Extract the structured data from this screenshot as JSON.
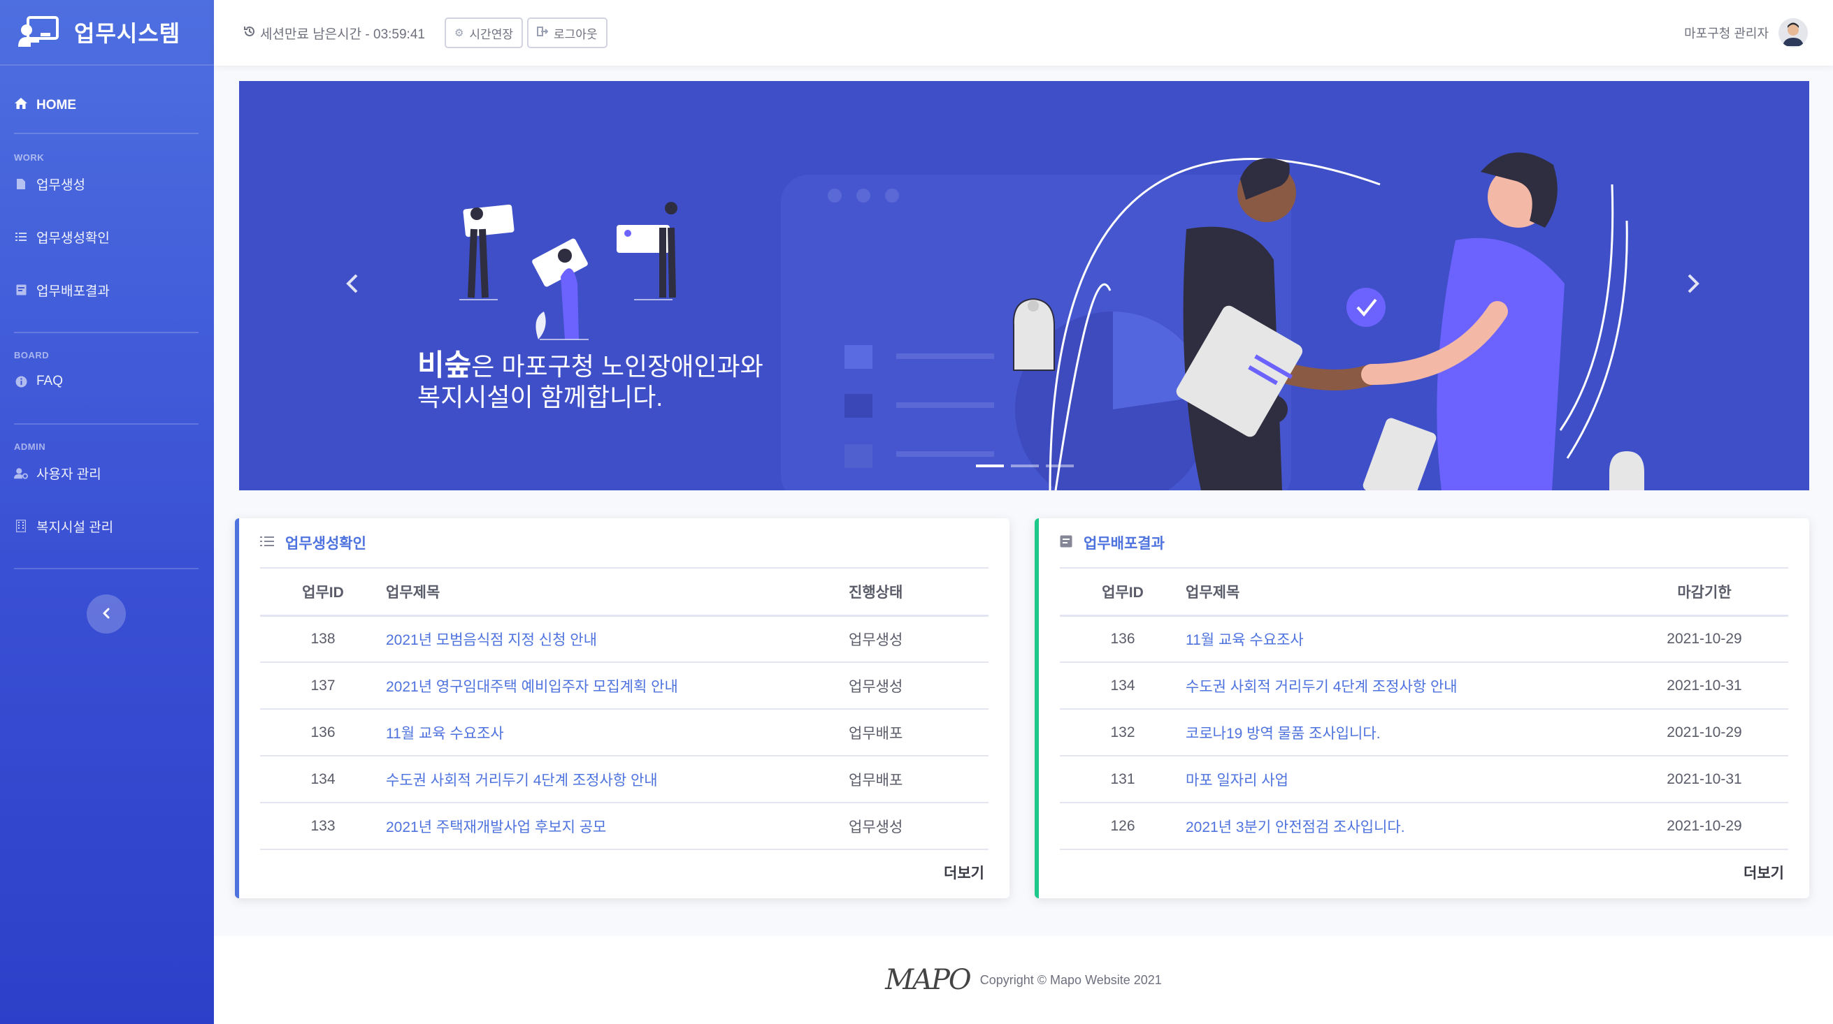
{
  "sidebar": {
    "brand": "업무시스템",
    "home": "HOME",
    "sections": [
      {
        "heading": "WORK",
        "items": [
          "업무생성",
          "업무생성확인",
          "업무배포결과"
        ]
      },
      {
        "heading": "BOARD",
        "items": [
          "FAQ"
        ]
      },
      {
        "heading": "ADMIN",
        "items": [
          "사용자 관리",
          "복지시설 관리"
        ]
      }
    ],
    "toggle_icon": "chevron-left-icon"
  },
  "topbar": {
    "session_text": "세션만료 남은시간 - 03:59:41",
    "extend_label": "시간연장",
    "logout_label": "로그아웃",
    "user_name": "마포구청 관리자"
  },
  "banner": {
    "highlight": "비숲",
    "line1_rest": "은 마포구청 노인장애인과와",
    "line2": "복지시설이 함께합니다.",
    "slide_count": 3,
    "active_slide": 1
  },
  "card_left": {
    "title": "업무생성확인",
    "headers": [
      "업무ID",
      "업무제목",
      "진행상태"
    ],
    "rows": [
      [
        "138",
        "2021년 모범음식점 지정 신청 안내",
        "업무생성"
      ],
      [
        "137",
        "2021년 영구임대주택 예비입주자 모집계획 안내",
        "업무생성"
      ],
      [
        "136",
        "11월 교육 수요조사",
        "업무배포"
      ],
      [
        "134",
        "수도권 사회적 거리두기 4단계 조정사항 안내",
        "업무배포"
      ],
      [
        "133",
        "2021년 주택재개발사업 후보지 공모",
        "업무생성"
      ]
    ],
    "more": "더보기"
  },
  "card_right": {
    "title": "업무배포결과",
    "headers": [
      "업무ID",
      "업무제목",
      "마감기한"
    ],
    "rows": [
      [
        "136",
        "11월 교육 수요조사",
        "2021-10-29"
      ],
      [
        "134",
        "수도권 사회적 거리두기 4단계 조정사항 안내",
        "2021-10-31"
      ],
      [
        "132",
        "코로나19 방역 물품 조사입니다.",
        "2021-10-29"
      ],
      [
        "131",
        "마포 일자리 사업",
        "2021-10-31"
      ],
      [
        "126",
        "2021년 3분기 안전점검 조사입니다.",
        "2021-10-29"
      ]
    ],
    "more": "더보기"
  },
  "footer": {
    "logo": "MAPO",
    "copyright": "Copyright © Mapo Website 2021"
  }
}
